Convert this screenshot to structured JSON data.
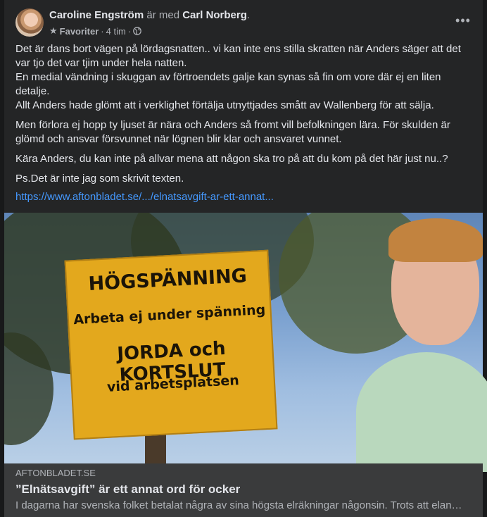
{
  "post": {
    "author": "Caroline Engström",
    "with_text": "är med",
    "tagged": "Carl Norberg",
    "tagged_suffix": ".",
    "audience_label": "Favoriter",
    "time": "4 tim",
    "dot": "·",
    "more_icon": "more-dots",
    "paragraphs": [
      "Det är dans bort vägen på lördagsnatten.. vi kan inte ens stilla skratten när Anders säger att det var tjo det var tjim under hela natten.",
      "En  medial vändning i skuggan av förtroendets galje kan synas så fin om vore där ej en liten detalje.",
      "Allt Anders hade glömt att i verklighet förtälja utnyttjades smått av Wallenberg för att sälja.",
      "Men förlora ej hopp ty ljuset är nära och Anders så fromt vill befolkningen lära. För skulden är glömd och ansvar försvunnet när lögnen blir klar och ansvaret vunnet.",
      "Kära Anders, du kan inte på allvar mena att någon ska tro på att du kom på det här just nu..?",
      "Ps.Det är inte jag som skrivit texten."
    ],
    "link": "https://www.aftonbladet.se/.../elnatsavgift-ar-ett-annat..."
  },
  "image": {
    "sign_lines": [
      "HÖGSPÄNNING",
      "Arbeta ej under spänning",
      "JORDA och KORTSLUT",
      "vid arbetsplatsen"
    ]
  },
  "preview": {
    "domain": "AFTONBLADET.SE",
    "title": "”Elnätsavgift” är ett annat ord för ocker",
    "description": "I dagarna har svenska folket betalat några av sina högsta elräkningar någonsin. Trots att elan…"
  },
  "colors": {
    "card_bg": "#242526",
    "link": "#4599ff",
    "sign_yellow": "#e3a81d"
  }
}
